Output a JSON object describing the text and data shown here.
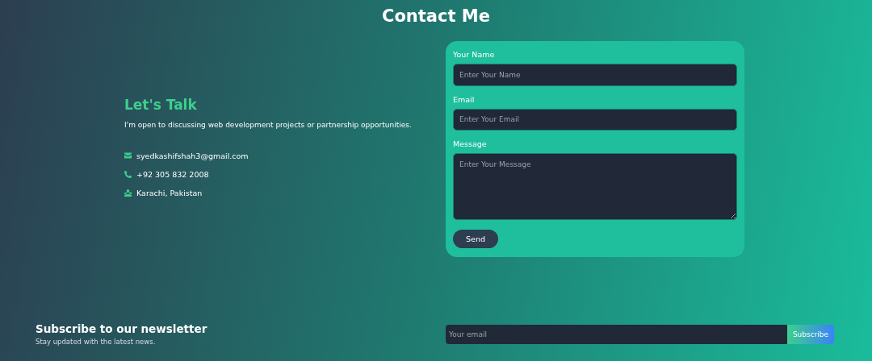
{
  "title": "Contact Me",
  "intro": {
    "heading": "Let's Talk",
    "text": "I'm open to discussing web development projects or partnership opportunities.",
    "contacts": [
      {
        "kind": "email",
        "text": "syedkashifshah3@gmail.com"
      },
      {
        "kind": "phone",
        "text": "+92 305 832 2008"
      },
      {
        "kind": "location",
        "text": "Karachi, Pakistan"
      }
    ]
  },
  "form": {
    "fields": [
      {
        "kind": "input",
        "label": "Your Name",
        "placeholder": "Enter Your Name"
      },
      {
        "kind": "input",
        "label": "Email",
        "placeholder": "Enter Your Email"
      },
      {
        "kind": "textarea",
        "label": "Message",
        "placeholder": "Enter Your Message"
      }
    ],
    "submit": "Send"
  },
  "newsletter": {
    "heading": "Subscribe to our newsletter",
    "text": "Stay updated with the latest news.",
    "placeholder": "Your email",
    "button": "Subscribe"
  }
}
